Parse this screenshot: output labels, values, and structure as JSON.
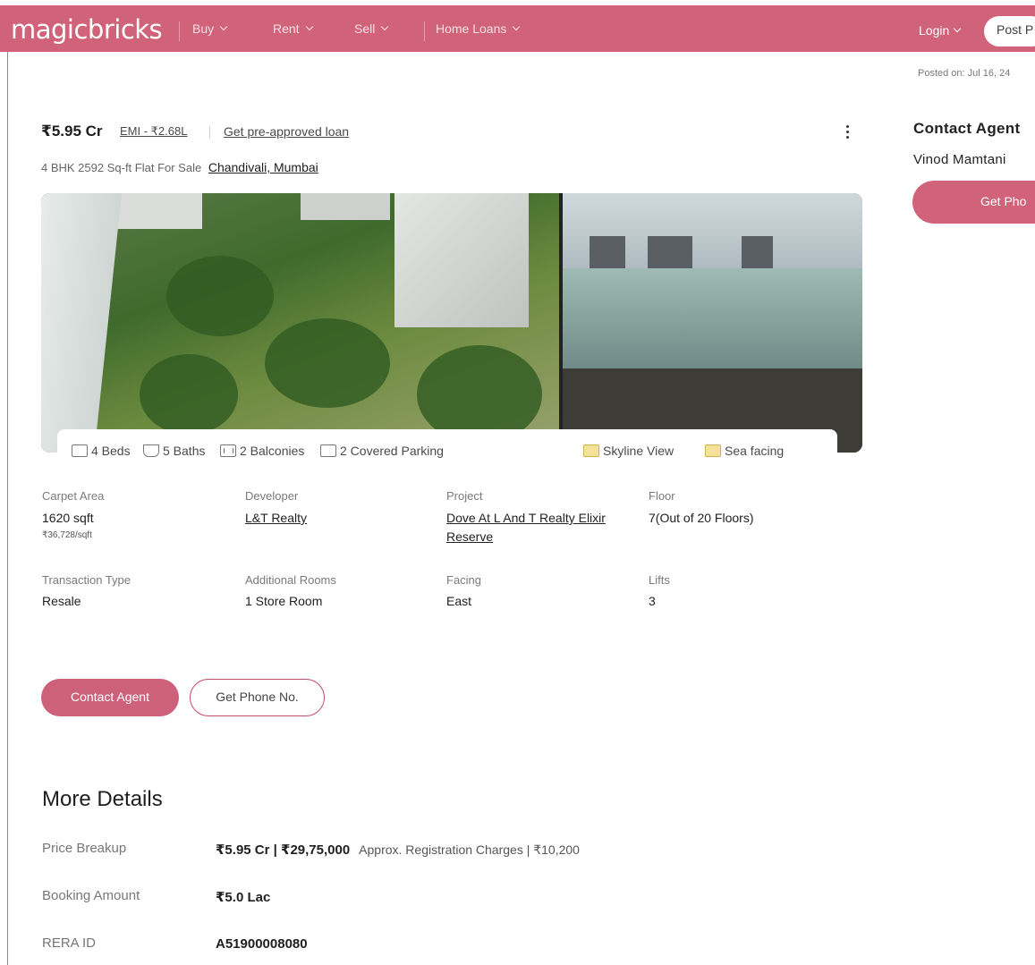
{
  "header": {
    "logo": "magicbricks",
    "nav": [
      {
        "label": "Buy"
      },
      {
        "label": "Rent"
      },
      {
        "label": "Sell"
      },
      {
        "label": "Home Loans"
      }
    ],
    "login": "Login",
    "post": "Post P"
  },
  "listing": {
    "price": "₹5.95 Cr",
    "emi": "EMI - ₹2.68L",
    "preapproved": "Get pre-approved loan",
    "subtitle": "4 BHK 2592 Sq-ft Flat For Sale",
    "location": "Chandivali, Mumbai",
    "posted": "Posted on: Jul 16, 24"
  },
  "agent": {
    "title": "Contact Agent",
    "name": "Vinod Mamtani",
    "phone_button": "Get Pho"
  },
  "amenities": [
    {
      "label": "4 Beds",
      "icon": "bed-icon"
    },
    {
      "label": "5 Baths",
      "icon": "bath-icon"
    },
    {
      "label": "2 Balconies",
      "icon": "balcony-icon"
    },
    {
      "label": "2 Covered Parking",
      "icon": "parking-icon"
    },
    {
      "label": "Skyline View",
      "icon": "skyline-icon"
    },
    {
      "label": "Sea facing",
      "icon": "sea-facing-icon"
    }
  ],
  "details": [
    {
      "label": "Carpet Area",
      "value": "1620 sqft",
      "sub": "₹36,728/sqft"
    },
    {
      "label": "Developer",
      "value": "L&T Realty"
    },
    {
      "label": "Project",
      "value": "Dove At L And T Realty Elixir",
      "value2": "Reserve"
    },
    {
      "label": "Floor",
      "value": "7(Out of 20 Floors)"
    },
    {
      "label": "Transaction Type",
      "value": "Resale"
    },
    {
      "label": "Additional Rooms",
      "value": "1 Store Room"
    },
    {
      "label": "Facing",
      "value": "East"
    },
    {
      "label": "Lifts",
      "value": "3"
    }
  ],
  "buttons": {
    "contact": "Contact Agent",
    "phone": "Get Phone No."
  },
  "more": {
    "title": "More Details",
    "rows": [
      {
        "label": "Price Breakup",
        "value": "₹5.95 Cr | ₹29,75,000",
        "note": "Approx. Registration Charges | ₹10,200"
      },
      {
        "label": "Booking Amount",
        "value": "₹5.0 Lac"
      },
      {
        "label": "RERA ID",
        "value": "A51900008080"
      }
    ]
  },
  "colors": {
    "brand": "#d0637a",
    "button": "#cc6179"
  }
}
